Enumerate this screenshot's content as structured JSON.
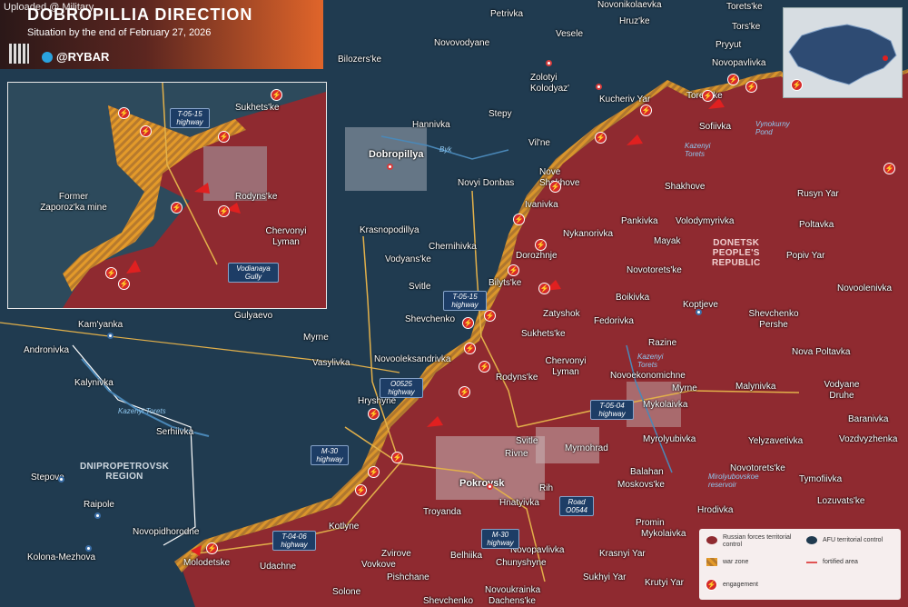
{
  "watermark": "Uploaded @ Military...",
  "header": {
    "title": "DOBROPILLIA DIRECTION",
    "subtitle": "Situation by the end of February 27, 2026",
    "brand": "@RYBAR"
  },
  "regions": {
    "dnipropetrovsk": "DNIPROPETROVSK\nREGION",
    "donetsk": "DONETSK\nPEOPLE'S\nREPUBLIC"
  },
  "towns": [
    "Petrivka",
    "Novonikolaevka",
    "Vesele",
    "Hruz'ke",
    "Torets'ke",
    "Tors'ke",
    "Novovodyane",
    "Bilozers'ke",
    "Zolotyi Kolodyaz'",
    "Pryyut",
    "Novopavlivka",
    "Kucheriv Yar",
    "Torets'ke",
    "Hannivka",
    "Stepy",
    "Sofiivka",
    "Dobropillya",
    "Vil'ne",
    "Nove Shakhove",
    "Shakhove",
    "Rusyn Yar",
    "Novyi Donbas",
    "Ivanivka",
    "Pankivka",
    "Volodymyrivka",
    "Poltavka",
    "Krasnopodillya",
    "Nykanorivka",
    "Mayak",
    "Chernihivka",
    "Dorozhnje",
    "Vodyans'ke",
    "Popiv Yar",
    "Novotorets'ke",
    "Bilyts'ke",
    "Svitle",
    "T-05-15",
    "Boikivka",
    "Novoolenivka",
    "Shevchenko",
    "Zatyshok",
    "Koptjeve",
    "Shevchenko Pershe",
    "Fedorivka",
    "Gulyaevo",
    "Kam'yanka",
    "Andronivka",
    "Myrne",
    "Sukhets'ke",
    "Razine",
    "Nova Poltavka",
    "Vasylivka",
    "Novooleksandrivka",
    "Chervonyi Lyman",
    "Novoekonomichne",
    "Rodyns'ke",
    "Kalynivka",
    "Myrne",
    "Malynivka",
    "Vodyane Druhe",
    "Hryshyne",
    "Mykolaivka",
    "Baranivka",
    "Serhiivka",
    "Svitle",
    "Myrnohrad",
    "Myrolyubivka",
    "Yelyzavetivka",
    "Vozdvyzhenka",
    "Rivne",
    "Balahan",
    "Novotorets'ke",
    "Stepove",
    "Pokrovsk",
    "Rih",
    "Moskovs'ke",
    "Tymofiivka",
    "Hnatyivka",
    "Raipole",
    "Troyanda",
    "Hrodivka",
    "Lozuvats'ke",
    "Novopidhorodne",
    "Kotlyne",
    "Promin",
    "Mykolaivka",
    "Kolona-Mezhova",
    "Molodetske",
    "Udachne",
    "Zvirove",
    "Belhiika",
    "Novopavlivka",
    "Vovkove",
    "Chunyshyne",
    "Krasnyi Yar",
    "Pishchane",
    "Sukhyi Yar",
    "Krutyi Yar",
    "Solone",
    "Novoukrainka",
    "Shevchenko",
    "Dachens'ke"
  ],
  "highways": [
    "T-05-15 highway",
    "O0525 highway",
    "T-05-04 highway",
    "M-30 highway",
    "Road O0544",
    "M-30 highway",
    "T-04-06 highway"
  ],
  "water": [
    "Byk",
    "Vynokurny Pond",
    "Kazenyi Torets",
    "Kazenyi Torets",
    "Mirolyubovskoe reservoir",
    "Kazenyi Torets"
  ],
  "inset": {
    "labels": [
      "Sukhets'ke",
      "T-05-15 highway",
      "Former Zaporoz'ka mine",
      "Rodyns'ke",
      "Chervonyi Lyman",
      "Vodianaya Gully"
    ]
  },
  "legend": {
    "russian": "Russian forces territorial control",
    "afu": "AFU territorial control",
    "war_zone": "war zone",
    "fortified": "fortified area",
    "engagement": "engagement"
  },
  "colors": {
    "russian": "#8f2a30",
    "afu": "#1f3a4f",
    "war_zone": "#e39a2a",
    "fortified": "#e05353",
    "engagement": "#d62a2a"
  }
}
